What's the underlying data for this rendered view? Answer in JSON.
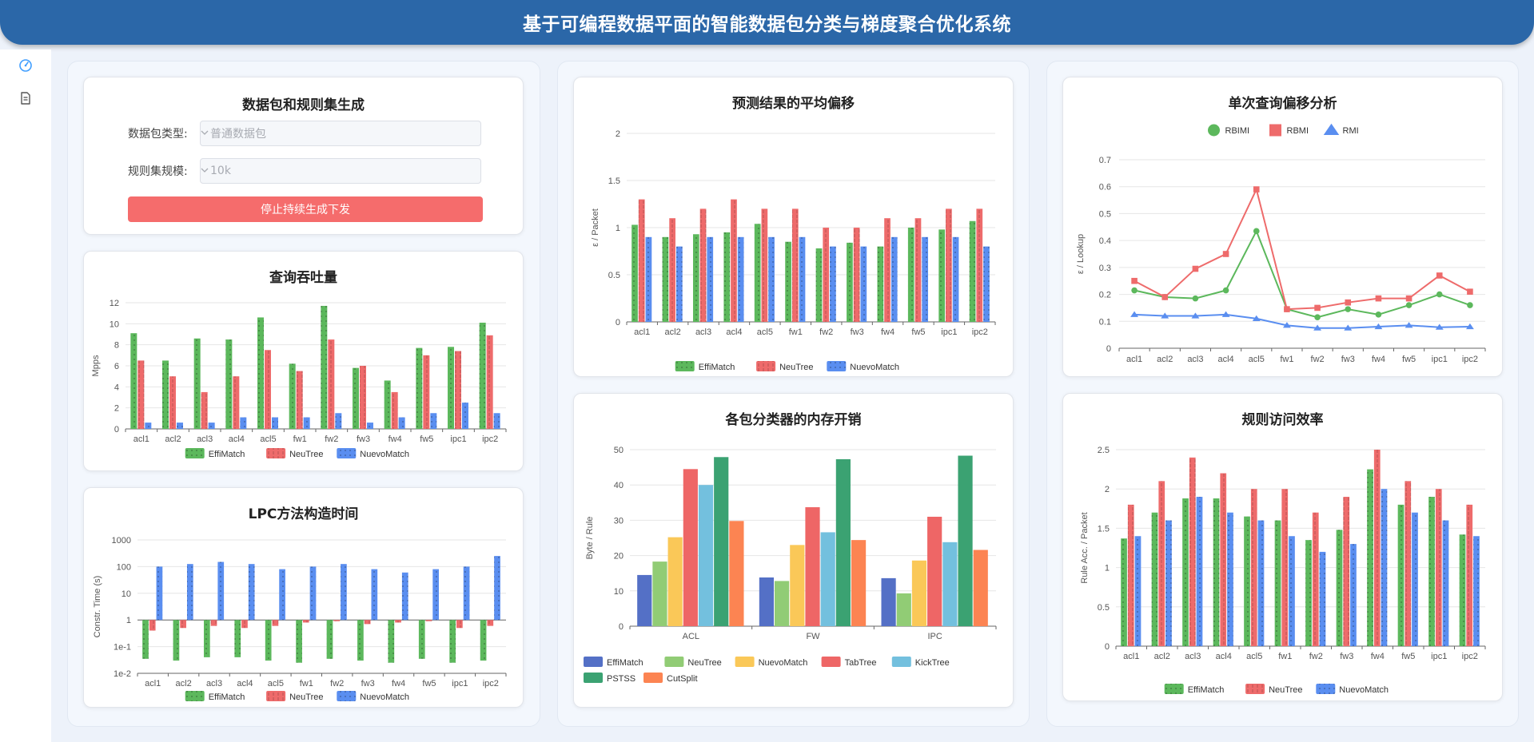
{
  "app": {
    "title": "基于可编程数据平面的智能数据包分类与梯度聚合优化系统"
  },
  "sidebar": {
    "items": [
      {
        "icon": "gauge-icon"
      },
      {
        "icon": "document-icon"
      }
    ]
  },
  "generator": {
    "title": "数据包和规则集生成",
    "packet_type_label": "数据包类型:",
    "packet_type_value": "普通数据包",
    "ruleset_size_label": "规则集规模:",
    "ruleset_size_value": "10k",
    "stop_button_label": "停止持续生成下发"
  },
  "colors": {
    "green": "#5cb85c",
    "red": "#ee6b6b",
    "blue": "#5a8ef0"
  },
  "charts": {
    "throughput": {
      "title": "查询吞吐量",
      "chart_data": {
        "type": "bar",
        "categories": [
          "acl1",
          "acl2",
          "acl3",
          "acl4",
          "acl5",
          "fw1",
          "fw2",
          "fw3",
          "fw4",
          "fw5",
          "ipc1",
          "ipc2"
        ],
        "ylabel": "Mpps",
        "ylim": [
          0,
          12
        ],
        "yticks": [
          "0",
          "2",
          "4",
          "6",
          "8",
          "10",
          "12"
        ],
        "series": [
          {
            "name": "EffiMatch",
            "color": "#5cb85c",
            "values": [
              9.1,
              6.5,
              8.6,
              8.5,
              10.6,
              6.2,
              11.7,
              5.8,
              4.6,
              7.7,
              7.8,
              10.1
            ]
          },
          {
            "name": "NeuTree",
            "color": "#ee6b6b",
            "values": [
              6.5,
              5.0,
              3.5,
              5.0,
              7.5,
              5.5,
              8.5,
              6.0,
              3.5,
              7.0,
              7.4,
              8.9
            ]
          },
          {
            "name": "NuevoMatch",
            "color": "#5a8ef0",
            "values": [
              0.6,
              0.6,
              0.6,
              1.1,
              1.1,
              1.1,
              1.5,
              0.6,
              1.1,
              1.5,
              2.5,
              1.5
            ]
          }
        ]
      }
    },
    "lpc": {
      "title": "LPC方法构造时间",
      "chart_data": {
        "type": "bar",
        "log_scale": true,
        "categories": [
          "acl1",
          "acl2",
          "acl3",
          "acl4",
          "acl5",
          "fw1",
          "fw2",
          "fw3",
          "fw4",
          "fw5",
          "ipc1",
          "ipc2"
        ],
        "ylabel": "Constr. Time (s)",
        "ylim": [
          0.01,
          1000
        ],
        "yticks": [
          "1e-2",
          "1e-1",
          "1",
          "10",
          "100",
          "1000"
        ],
        "series": [
          {
            "name": "EffiMatch",
            "color": "#5cb85c",
            "values": [
              0.035,
              0.03,
              0.04,
              0.04,
              0.03,
              0.025,
              0.035,
              0.03,
              0.025,
              0.035,
              0.025,
              0.03
            ]
          },
          {
            "name": "NeuTree",
            "color": "#ee6b6b",
            "values": [
              0.4,
              0.5,
              0.6,
              0.5,
              0.6,
              0.8,
              0.9,
              0.7,
              0.8,
              0.9,
              0.5,
              0.6
            ]
          },
          {
            "name": "NuevoMatch",
            "color": "#5a8ef0",
            "values": [
              100,
              125,
              150,
              125,
              80,
              100,
              125,
              80,
              60,
              80,
              100,
              250
            ]
          }
        ]
      }
    },
    "avg_offset": {
      "title": "预测结果的平均偏移",
      "chart_data": {
        "type": "bar",
        "categories": [
          "acl1",
          "acl2",
          "acl3",
          "acl4",
          "acl5",
          "fw1",
          "fw2",
          "fw3",
          "fw4",
          "fw5",
          "ipc1",
          "ipc2"
        ],
        "ylabel": "ε / Packet",
        "ylim": [
          0,
          2
        ],
        "yticks": [
          "0",
          "0.5",
          "1",
          "1.5",
          "2"
        ],
        "series": [
          {
            "name": "EffiMatch",
            "color": "#5cb85c",
            "values": [
              1.03,
              0.9,
              0.93,
              0.95,
              1.04,
              0.85,
              0.78,
              0.84,
              0.8,
              1.0,
              0.98,
              1.07
            ]
          },
          {
            "name": "NeuTree",
            "color": "#ee6b6b",
            "values": [
              1.3,
              1.1,
              1.2,
              1.3,
              1.2,
              1.2,
              1.0,
              1.0,
              1.1,
              1.1,
              1.2,
              1.2
            ]
          },
          {
            "name": "NuevoMatch",
            "color": "#5a8ef0",
            "values": [
              0.9,
              0.8,
              0.9,
              0.9,
              0.9,
              0.9,
              0.8,
              0.8,
              0.9,
              0.9,
              0.9,
              0.8
            ]
          }
        ]
      }
    },
    "memory": {
      "title": "各包分类器的内存开销",
      "chart_data": {
        "type": "bar",
        "categories": [
          "ACL",
          "FW",
          "IPC"
        ],
        "ylabel": "Byte / Rule",
        "ylim": [
          0,
          50
        ],
        "yticks": [
          "0",
          "10",
          "20",
          "30",
          "40",
          "50"
        ],
        "series": [
          {
            "name": "EffiMatch",
            "color": "#5470c6",
            "values": [
              14.5,
              13.8,
              13.6
            ]
          },
          {
            "name": "NeuTree",
            "color": "#91cc75",
            "values": [
              18.3,
              12.8,
              9.3
            ]
          },
          {
            "name": "NuevoMatch",
            "color": "#fac858",
            "values": [
              25.2,
              23.0,
              18.6
            ]
          },
          {
            "name": "TabTree",
            "color": "#ee6666",
            "values": [
              44.5,
              33.7,
              31.0
            ]
          },
          {
            "name": "KickTree",
            "color": "#73c0de",
            "values": [
              40.0,
              26.6,
              23.8
            ]
          },
          {
            "name": "PSTSS",
            "color": "#3ba272",
            "values": [
              47.9,
              47.3,
              48.3
            ]
          },
          {
            "name": "CutSplit",
            "color": "#fc8452",
            "values": [
              29.8,
              24.4,
              21.6
            ]
          }
        ]
      }
    },
    "single_query": {
      "title": "单次查询偏移分析",
      "chart_data": {
        "type": "line",
        "categories": [
          "acl1",
          "acl2",
          "acl3",
          "acl4",
          "acl5",
          "fw1",
          "fw2",
          "fw3",
          "fw4",
          "fw5",
          "ipc1",
          "ipc2"
        ],
        "ylabel": "ε / Lookup",
        "ylim": [
          0,
          0.7
        ],
        "yticks": [
          "0",
          "0.1",
          "0.2",
          "0.3",
          "0.4",
          "0.5",
          "0.6",
          "0.7"
        ],
        "series": [
          {
            "name": "RBIMI",
            "color": "#5cb85c",
            "marker": "circle",
            "values": [
              0.215,
              0.19,
              0.185,
              0.215,
              0.435,
              0.145,
              0.115,
              0.145,
              0.125,
              0.16,
              0.2,
              0.16
            ]
          },
          {
            "name": "RBMI",
            "color": "#ee6b6b",
            "marker": "square",
            "values": [
              0.25,
              0.19,
              0.295,
              0.35,
              0.59,
              0.145,
              0.15,
              0.17,
              0.185,
              0.185,
              0.27,
              0.21
            ]
          },
          {
            "name": "RMI",
            "color": "#5a8ef0",
            "marker": "triangle",
            "values": [
              0.125,
              0.12,
              0.12,
              0.125,
              0.11,
              0.085,
              0.075,
              0.075,
              0.08,
              0.085,
              0.078,
              0.08
            ]
          }
        ]
      }
    },
    "rule_access": {
      "title": "规则访问效率",
      "chart_data": {
        "type": "bar",
        "categories": [
          "acl1",
          "acl2",
          "acl3",
          "acl4",
          "acl5",
          "fw1",
          "fw2",
          "fw3",
          "fw4",
          "fw5",
          "ipc1",
          "ipc2"
        ],
        "ylabel": "Rule Acc. / Packet",
        "ylim": [
          0,
          2.5
        ],
        "yticks": [
          "0",
          "0.5",
          "1",
          "1.5",
          "2",
          "2.5"
        ],
        "series": [
          {
            "name": "EffiMatch",
            "color": "#5cb85c",
            "values": [
              1.37,
              1.7,
              1.88,
              1.88,
              1.65,
              1.6,
              1.35,
              1.48,
              2.25,
              1.8,
              1.9,
              1.42
            ]
          },
          {
            "name": "NeuTree",
            "color": "#ee6b6b",
            "values": [
              1.8,
              2.1,
              2.4,
              2.2,
              2.0,
              2.0,
              1.7,
              1.9,
              2.5,
              2.1,
              2.0,
              1.8
            ]
          },
          {
            "name": "NuevoMatch",
            "color": "#5a8ef0",
            "values": [
              1.4,
              1.6,
              1.9,
              1.7,
              1.6,
              1.4,
              1.2,
              1.3,
              2.0,
              1.7,
              1.6,
              1.4
            ]
          }
        ]
      }
    }
  }
}
